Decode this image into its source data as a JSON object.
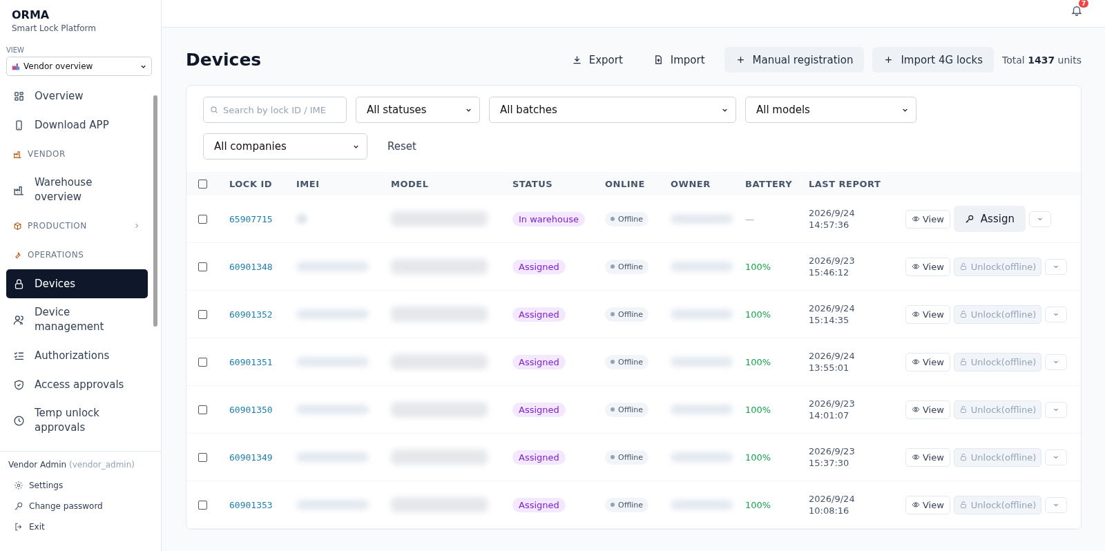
{
  "brand": {
    "name": "ORMA",
    "subtitle": "Smart Lock Platform"
  },
  "view": {
    "label": "VIEW",
    "value": "Vendor overview"
  },
  "sidebar": {
    "items": [
      {
        "kind": "item",
        "label": "Overview",
        "selected": false
      },
      {
        "kind": "item",
        "label": "Download APP",
        "selected": false
      },
      {
        "kind": "section",
        "label": "VENDOR",
        "expandable": false
      },
      {
        "kind": "item",
        "label": "Warehouse overview",
        "selected": false
      },
      {
        "kind": "section",
        "label": "PRODUCTION",
        "expandable": true
      },
      {
        "kind": "section",
        "label": "OPERATIONS",
        "expandable": false
      },
      {
        "kind": "item",
        "label": "Devices",
        "selected": true
      },
      {
        "kind": "item",
        "label": "Device management",
        "selected": false
      },
      {
        "kind": "item",
        "label": "Authorizations",
        "selected": false
      },
      {
        "kind": "item",
        "label": "Access approvals",
        "selected": false
      },
      {
        "kind": "item",
        "label": "Temp unlock approvals",
        "selected": false
      }
    ]
  },
  "user": {
    "name": "Vendor Admin",
    "role": "(vendor_admin)",
    "links": [
      "Settings",
      "Change password",
      "Exit"
    ]
  },
  "notifications": {
    "count": "7"
  },
  "page": {
    "title": "Devices",
    "actions": [
      {
        "kind": "plain",
        "label": "Export"
      },
      {
        "kind": "plain",
        "label": "Import"
      },
      {
        "kind": "filled",
        "label": "Manual registration"
      },
      {
        "kind": "filled",
        "label": "Import 4G locks"
      }
    ],
    "total_prefix": "Total",
    "total": "1437",
    "total_suffix": "units"
  },
  "filters": {
    "search": {
      "placeholder": "Search by lock ID / IME"
    },
    "selects": [
      "All statuses",
      "All batches",
      "All models",
      "All companies"
    ],
    "reset": "Reset"
  },
  "table": {
    "columns": [
      "LOCK ID",
      "IMEI",
      "MODEL",
      "STATUS",
      "ONLINE",
      "OWNER",
      "BATTERY",
      "LAST REPORT"
    ],
    "all_checked": false,
    "rows": [
      {
        "checked": false,
        "lock_id": "65907715",
        "imei_redacted": false,
        "status": "In warehouse",
        "online": false,
        "online_label": "Offline",
        "battery": "—",
        "battery_ok": false,
        "date": "2026/9/24",
        "time": "14:57:36",
        "view": "View",
        "action": {
          "kind": "assign",
          "label": "Assign",
          "disabled": false
        }
      },
      {
        "checked": false,
        "lock_id": "60901348",
        "imei_redacted": true,
        "status": "Assigned",
        "online": false,
        "online_label": "Offline",
        "battery": "100%",
        "battery_ok": true,
        "date": "2026/9/23",
        "time": "15:46:12",
        "view": "View",
        "action": {
          "kind": "unlock",
          "label": "Unlock(offline)",
          "disabled": true
        }
      },
      {
        "checked": false,
        "lock_id": "60901352",
        "imei_redacted": true,
        "status": "Assigned",
        "online": false,
        "online_label": "Offline",
        "battery": "100%",
        "battery_ok": true,
        "date": "2026/9/24",
        "time": "15:14:35",
        "view": "View",
        "action": {
          "kind": "unlock",
          "label": "Unlock(offline)",
          "disabled": true
        }
      },
      {
        "checked": false,
        "lock_id": "60901351",
        "imei_redacted": true,
        "status": "Assigned",
        "online": false,
        "online_label": "Offline",
        "battery": "100%",
        "battery_ok": true,
        "date": "2026/9/24",
        "time": "13:55:01",
        "view": "View",
        "action": {
          "kind": "unlock",
          "label": "Unlock(offline)",
          "disabled": true
        }
      },
      {
        "checked": false,
        "lock_id": "60901350",
        "imei_redacted": true,
        "status": "Assigned",
        "online": false,
        "online_label": "Offline",
        "battery": "100%",
        "battery_ok": true,
        "date": "2026/9/23",
        "time": "14:01:07",
        "view": "View",
        "action": {
          "kind": "unlock",
          "label": "Unlock(offline)",
          "disabled": true
        }
      },
      {
        "checked": false,
        "lock_id": "60901349",
        "imei_redacted": true,
        "status": "Assigned",
        "online": false,
        "online_label": "Offline",
        "battery": "100%",
        "battery_ok": true,
        "date": "2026/9/23",
        "time": "15:37:30",
        "view": "View",
        "action": {
          "kind": "unlock",
          "label": "Unlock(offline)",
          "disabled": true
        }
      },
      {
        "checked": false,
        "lock_id": "60901353",
        "imei_redacted": true,
        "status": "Assigned",
        "online": false,
        "online_label": "Offline",
        "battery": "100%",
        "battery_ok": true,
        "date": "2026/9/24",
        "time": "10:08:16",
        "view": "View",
        "action": {
          "kind": "unlock",
          "label": "Unlock(offline)",
          "disabled": true
        }
      }
    ]
  }
}
